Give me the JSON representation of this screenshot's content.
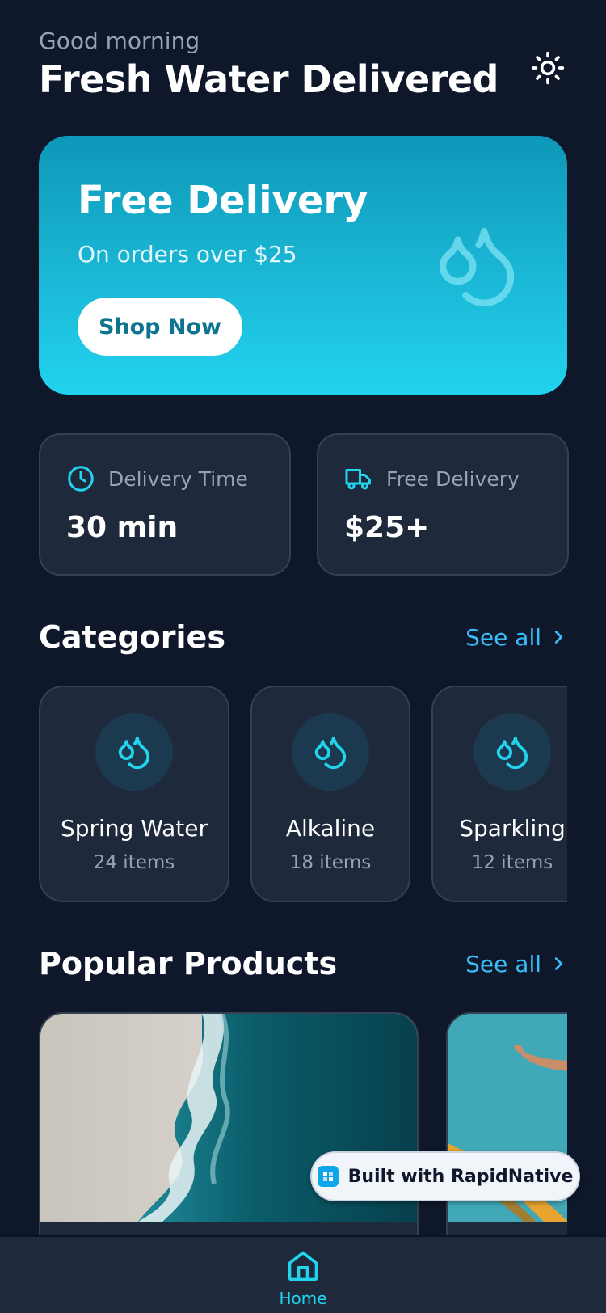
{
  "header": {
    "greeting": "Good morning",
    "title": "Fresh Water Delivered",
    "theme_icon": "sun-icon"
  },
  "banner": {
    "title": "Free Delivery",
    "subtitle": "On orders over $25",
    "button_label": "Shop Now",
    "icon": "water-drops-icon"
  },
  "stats": [
    {
      "icon": "clock-icon",
      "label": "Delivery Time",
      "value": "30 min"
    },
    {
      "icon": "truck-icon",
      "label": "Free Delivery",
      "value": "$25+"
    }
  ],
  "categories": {
    "title": "Categories",
    "see_all": "See all",
    "items": [
      {
        "name": "Spring Water",
        "count": "24 items",
        "icon": "water-drops-icon"
      },
      {
        "name": "Alkaline",
        "count": "18 items",
        "icon": "water-drops-icon"
      },
      {
        "name": "Sparkling",
        "count": "12 items",
        "icon": "water-drops-icon"
      }
    ]
  },
  "popular": {
    "title": "Popular Products",
    "see_all": "See all"
  },
  "badge": {
    "text": "Built with RapidNative"
  },
  "nav": {
    "home_label": "Home"
  },
  "colors": {
    "background": "#0f172a",
    "card": "#1e293b",
    "accent": "#22d3ee",
    "link": "#38bdf8"
  }
}
